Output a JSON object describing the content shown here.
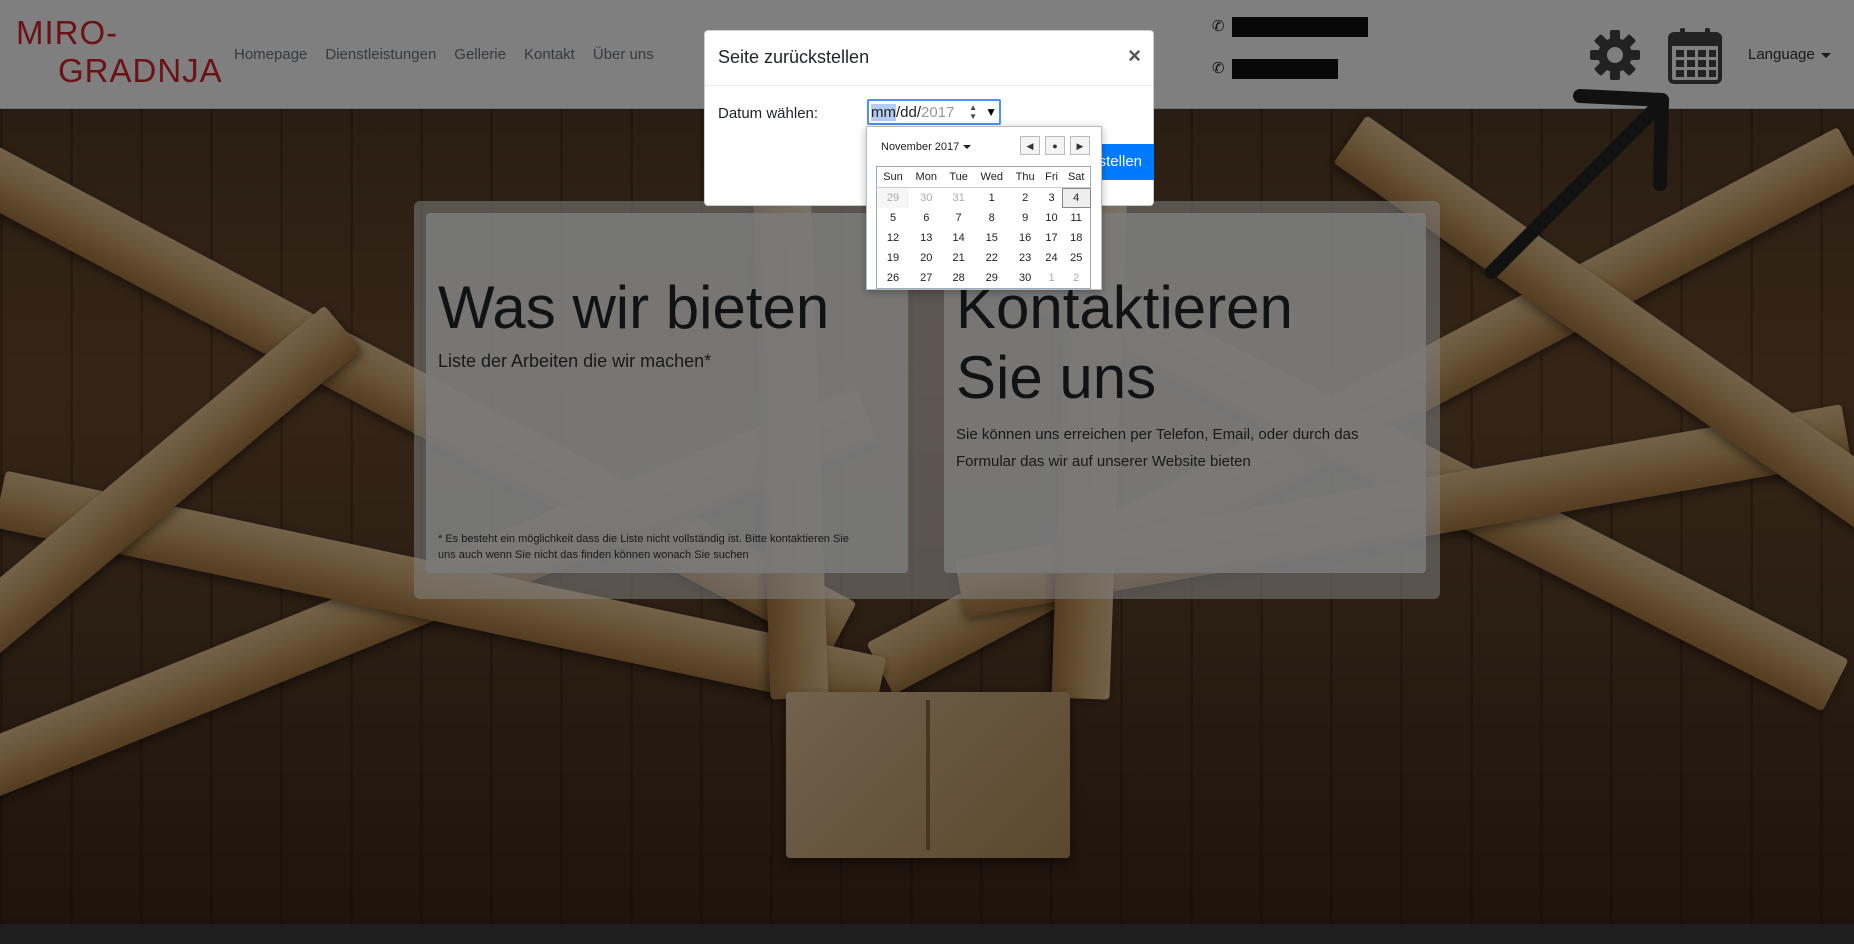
{
  "logo": {
    "line1": "MIRO-",
    "line2": "GRADNJA"
  },
  "nav": [
    "Homepage",
    "Dienstleistungen",
    "Gellerie",
    "Kontakt",
    "Über uns"
  ],
  "header": {
    "language_label": "Language"
  },
  "icons": {
    "phone": "phone-icon",
    "settings": "gear-icon",
    "calendar": "calendar-icon"
  },
  "cards": {
    "left": {
      "title": "Was wir bieten",
      "subtitle": "Liste der Arbeiten die wir machen*",
      "note": "* Es besteht ein möglichkeit dass die Liste nicht vollständig ist. Bitte kontaktieren Sie uns auch wenn Sie nicht das finden können wonach Sie suchen"
    },
    "right": {
      "title": "Kontaktieren Sie uns",
      "text": "Sie können uns erreichen per Telefon, Email, oder durch das Formular das wir auf unserer Website bieten"
    }
  },
  "modal": {
    "title": "Seite zurückstellen",
    "close": "×",
    "date_label": "Datum wählen:",
    "date_value": {
      "mm": "mm",
      "sep1": "/",
      "dd": "dd",
      "sep2": "/",
      "yyyy": "2017"
    },
    "restore_button": "stellen"
  },
  "datepicker": {
    "month_label": "November 2017",
    "weekdays": [
      "Sun",
      "Mon",
      "Tue",
      "Wed",
      "Thu",
      "Fri",
      "Sat"
    ],
    "weeks": [
      [
        "29",
        "30",
        "31",
        "1",
        "2",
        "3",
        "4"
      ],
      [
        "5",
        "6",
        "7",
        "8",
        "9",
        "10",
        "11"
      ],
      [
        "12",
        "13",
        "14",
        "15",
        "16",
        "17",
        "18"
      ],
      [
        "19",
        "20",
        "21",
        "22",
        "23",
        "24",
        "25"
      ],
      [
        "26",
        "27",
        "28",
        "29",
        "30",
        "1",
        "2"
      ]
    ],
    "today": "4"
  },
  "colors": {
    "brand": "#d9242b",
    "primary": "#007bff",
    "focus": "#4d90fe"
  }
}
